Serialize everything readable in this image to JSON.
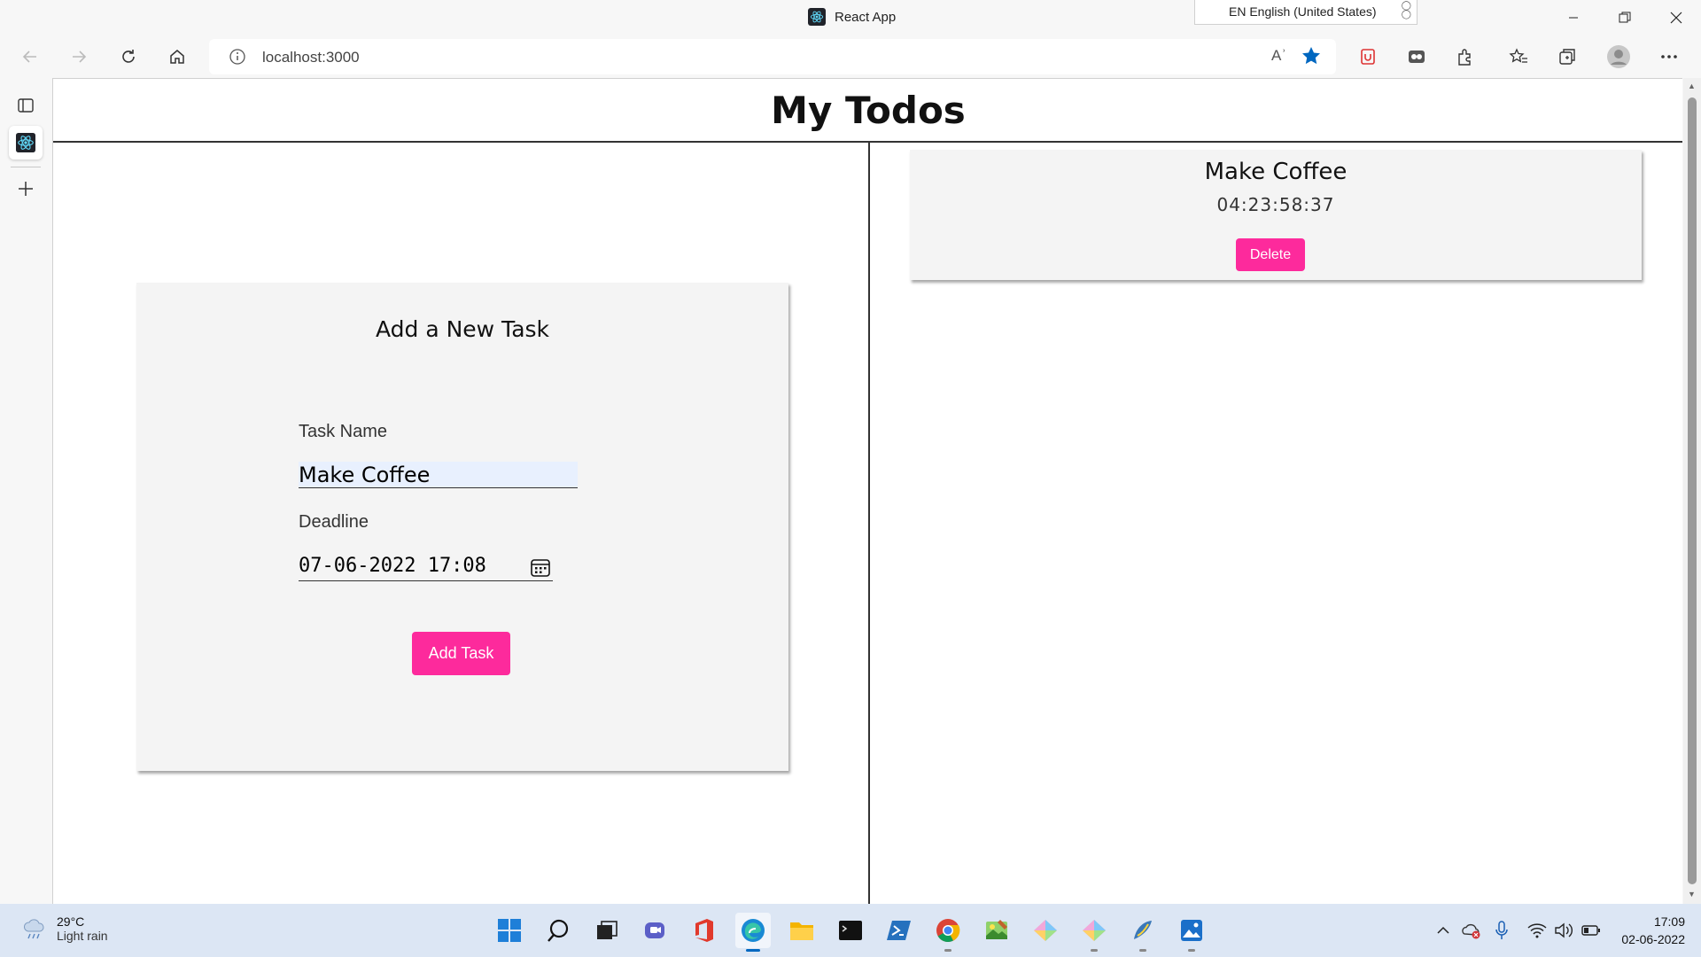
{
  "window": {
    "title": "React App",
    "ime_indicator": "EN English (United States)"
  },
  "browser": {
    "url": "localhost:3000",
    "read_aloud_glyph": "Aʾ"
  },
  "page": {
    "title": "My Todos",
    "form": {
      "heading": "Add a New Task",
      "task_name_label": "Task Name",
      "task_name_value": "Make Coffee",
      "deadline_label": "Deadline",
      "deadline_value": "07-06-2022 17:08",
      "submit_label": "Add Task"
    },
    "todos": [
      {
        "name": "Make Coffee",
        "countdown": "04:23:58:37",
        "delete_label": "Delete"
      }
    ]
  },
  "taskbar": {
    "weather_temp": "29°C",
    "weather_condition": "Light rain",
    "time": "17:09",
    "date": "02-06-2022"
  },
  "colors": {
    "accent_button": "#fd2a9c",
    "autofill_input": "#e8f0fe",
    "edge_blue": "#0067c0"
  }
}
